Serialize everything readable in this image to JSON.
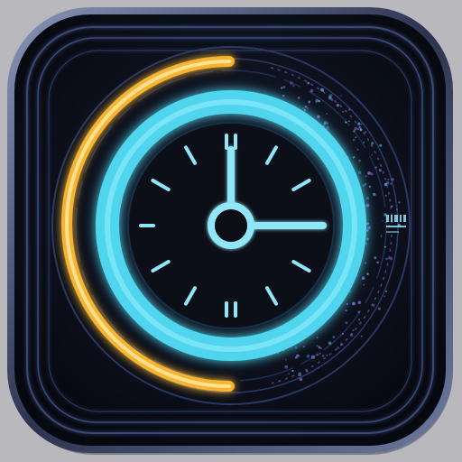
{
  "icon": {
    "semantic": "clock-icon",
    "label_text": "",
    "clock_time": {
      "hour": 3,
      "minute": 0
    },
    "progress_arc_fraction": 0.5
  },
  "colors": {
    "page_background": "#b9b9bd",
    "tile_background": "#0b0e18",
    "tile_border": "#5a6790",
    "accent_cyan": "#4fd6ee",
    "accent_orange": "#f5b431",
    "dial_face": "#0c0f18",
    "circuit_purple": "#6f5aa8"
  }
}
